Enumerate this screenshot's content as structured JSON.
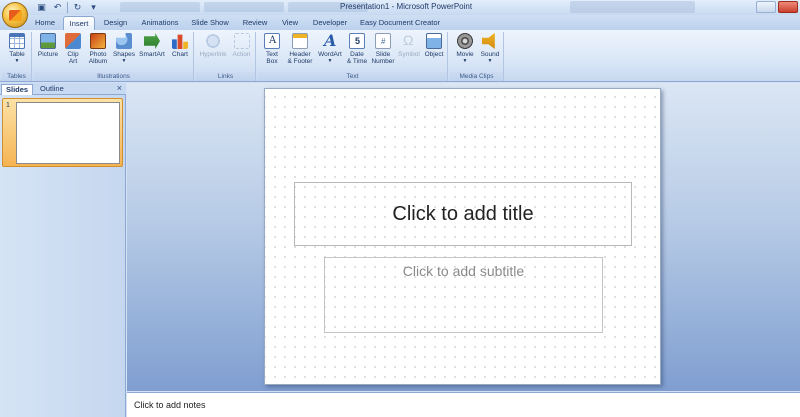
{
  "window": {
    "title": "Presentation1 - Microsoft PowerPoint"
  },
  "ribbon_tabs": [
    {
      "label": "Home"
    },
    {
      "label": "Insert",
      "active": true
    },
    {
      "label": "Design"
    },
    {
      "label": "Animations"
    },
    {
      "label": "Slide Show"
    },
    {
      "label": "Review"
    },
    {
      "label": "View"
    },
    {
      "label": "Developer"
    },
    {
      "label": "Easy Document Creator"
    }
  ],
  "groups": {
    "tables": {
      "label": "Tables",
      "buttons": [
        {
          "label": "Table",
          "icon": "table-icon"
        }
      ]
    },
    "illustrations": {
      "label": "Illustrations",
      "buttons": [
        {
          "label": "Picture",
          "icon": "picture-icon"
        },
        {
          "label": "Clip\nArt",
          "icon": "clipart-icon"
        },
        {
          "label": "Photo\nAlbum",
          "icon": "photo-album-icon"
        },
        {
          "label": "Shapes",
          "icon": "shapes-icon"
        },
        {
          "label": "SmartArt",
          "icon": "smartart-icon"
        },
        {
          "label": "Chart",
          "icon": "chart-icon"
        }
      ]
    },
    "links": {
      "label": "Links",
      "buttons": [
        {
          "label": "Hyperlink",
          "icon": "hyperlink-icon",
          "disabled": true
        },
        {
          "label": "Action",
          "icon": "action-icon",
          "disabled": true
        }
      ]
    },
    "text": {
      "label": "Text",
      "buttons": [
        {
          "label": "Text\nBox",
          "icon": "textbox-icon"
        },
        {
          "label": "Header\n& Footer",
          "icon": "header-footer-icon"
        },
        {
          "label": "WordArt",
          "icon": "wordart-icon"
        },
        {
          "label": "Date\n& Time",
          "icon": "date-time-icon"
        },
        {
          "label": "Slide\nNumber",
          "icon": "slide-number-icon"
        },
        {
          "label": "Symbol",
          "icon": "symbol-icon",
          "disabled": true
        },
        {
          "label": "Object",
          "icon": "object-icon"
        }
      ]
    },
    "media": {
      "label": "Media Clips",
      "buttons": [
        {
          "label": "Movie",
          "icon": "movie-icon"
        },
        {
          "label": "Sound",
          "icon": "sound-icon"
        }
      ]
    }
  },
  "panel": {
    "tabs": [
      {
        "label": "Slides",
        "active": true
      },
      {
        "label": "Outline"
      }
    ],
    "close_glyph": "×",
    "slides": [
      {
        "number": "1"
      }
    ]
  },
  "slide": {
    "title_placeholder": "Click to add title",
    "subtitle_placeholder": "Click to add subtitle"
  },
  "notes": {
    "placeholder": "Click to add notes"
  },
  "colors": {
    "accent": "#f6b453",
    "ribbon": "#dce8f7",
    "workspace": "#7f9ed0"
  }
}
